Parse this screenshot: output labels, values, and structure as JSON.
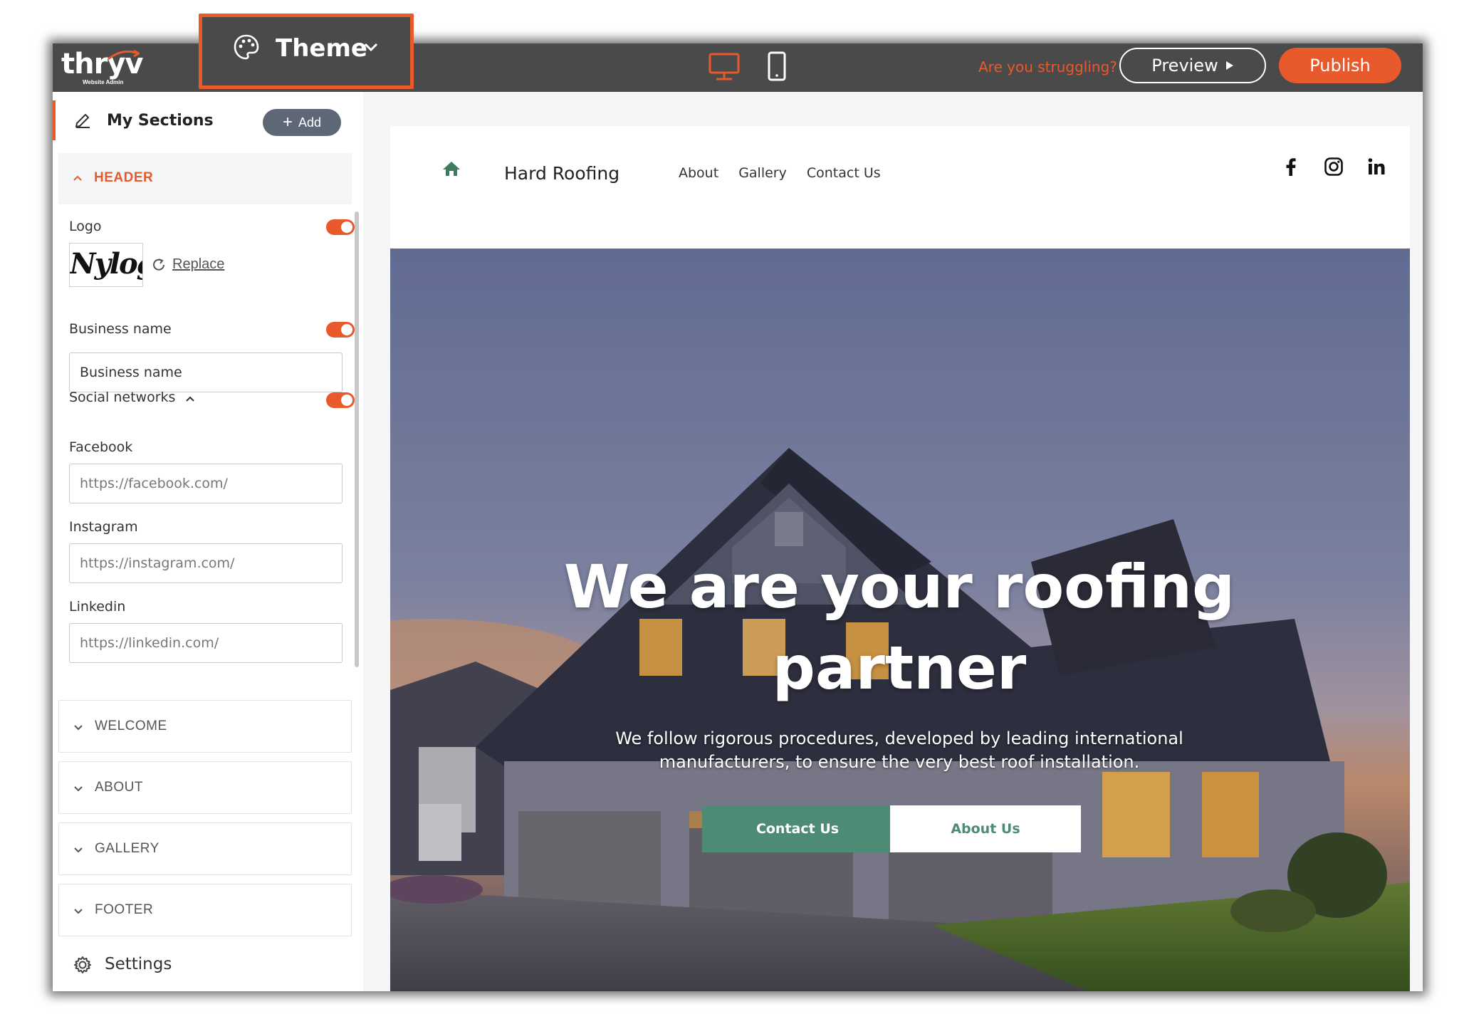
{
  "brand": {
    "logo_word": "thryv",
    "logo_tag": "Website Admin"
  },
  "topbar": {
    "theme_label": "Theme",
    "struggling_text": "Are you struggling?",
    "preview_label": "Preview",
    "publish_label": "Publish"
  },
  "colors": {
    "accent": "#e8592b",
    "topbar": "#4a4a4a",
    "site_green": "#4e8b77"
  },
  "sidebar": {
    "title": "My Sections",
    "add_label": "Add",
    "header_section": {
      "title": "HEADER",
      "logo_label": "Logo",
      "logo_enabled": true,
      "logo_text": "Nylog",
      "replace_label": "Replace",
      "business_name_label": "Business name",
      "business_name_enabled": true,
      "business_name_value": "Business name",
      "social_label": "Social networks",
      "social_enabled": true,
      "facebook_label": "Facebook",
      "facebook_placeholder": "https://facebook.com/",
      "instagram_label": "Instagram",
      "instagram_placeholder": "https://instagram.com/",
      "linkedin_label": "Linkedin",
      "linkedin_placeholder": "https://linkedin.com/"
    },
    "sections": [
      "WELCOME",
      "ABOUT",
      "GALLERY",
      "FOOTER"
    ],
    "settings_label": "Settings"
  },
  "site": {
    "name": "Hard Roofing",
    "nav": [
      "About",
      "Gallery",
      "Contact Us"
    ],
    "social_icons": [
      "facebook-icon",
      "instagram-icon",
      "linkedin-icon"
    ],
    "hero": {
      "title": "We are your roofing partner",
      "subtitle": "We follow rigorous procedures, developed by leading international manufacturers, to ensure the very best roof installation.",
      "primary_button": "Contact Us",
      "secondary_button": "About Us"
    }
  }
}
